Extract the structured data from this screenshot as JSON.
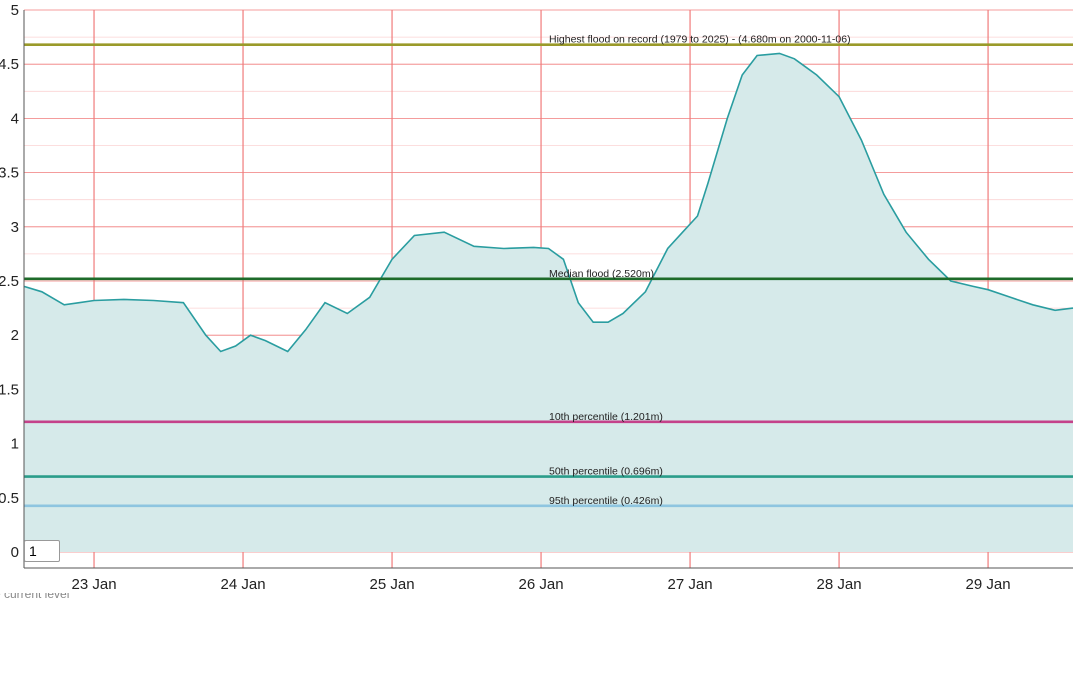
{
  "chart_data": {
    "type": "area",
    "title": "",
    "xlabel": "",
    "ylabel": "",
    "ylim": [
      0,
      5
    ],
    "y_ticks": [
      "0",
      "0.5",
      "1",
      "1.5",
      "2",
      "2.5",
      "3",
      "3.5",
      "4",
      "4.5",
      "5"
    ],
    "x_ticks": [
      "23 Jan",
      "24 Jan",
      "25 Jan",
      "26 Jan",
      "27 Jan",
      "28 Jan",
      "29 Jan"
    ],
    "x_unit": "days since 23 Jan 00:00",
    "x_range": [
      -0.47,
      6.57
    ],
    "grid": true,
    "series": [
      {
        "name": "",
        "color": "#2a9da0",
        "fill": "#d6eaea",
        "x": [
          -0.47,
          -0.35,
          -0.2,
          -0.1,
          0.0,
          0.2,
          0.4,
          0.6,
          0.75,
          0.85,
          0.95,
          1.05,
          1.15,
          1.3,
          1.42,
          1.55,
          1.7,
          1.85,
          2.0,
          2.15,
          2.35,
          2.55,
          2.75,
          2.95,
          3.05,
          3.15,
          3.25,
          3.35,
          3.45,
          3.55,
          3.7,
          3.85,
          3.95,
          4.05,
          4.12,
          4.25,
          4.35,
          4.45,
          4.6,
          4.7,
          4.75,
          4.85,
          5.0,
          5.15,
          5.3,
          5.45,
          5.6,
          5.75,
          5.9,
          6.0,
          6.15,
          6.3,
          6.45,
          6.57
        ],
        "values": [
          2.45,
          2.4,
          2.28,
          2.3,
          2.32,
          2.33,
          2.32,
          2.3,
          2.0,
          1.85,
          1.9,
          2.0,
          1.95,
          1.85,
          2.05,
          2.3,
          2.2,
          2.35,
          2.7,
          2.92,
          2.95,
          2.82,
          2.8,
          2.81,
          2.8,
          2.7,
          2.3,
          2.12,
          2.12,
          2.2,
          2.4,
          2.8,
          2.95,
          3.1,
          3.4,
          4.0,
          4.4,
          4.58,
          4.6,
          4.55,
          4.5,
          4.4,
          4.2,
          3.8,
          3.3,
          2.95,
          2.7,
          2.5,
          2.45,
          2.42,
          2.35,
          2.28,
          2.23,
          2.25
        ]
      }
    ],
    "reference_lines": [
      {
        "label": "Highest flood on record (1979 to 2025) - (4.680m on 2000-11-06)",
        "value": 4.68,
        "color": "#9a9a2a"
      },
      {
        "label": "Median flood (2.520m)",
        "value": 2.52,
        "color": "#1e6b2a"
      },
      {
        "label": "10th percentile (1.201m)",
        "value": 1.201,
        "color": "#c4428a"
      },
      {
        "label": "50th percentile (0.696m)",
        "value": 0.696,
        "color": "#2a9d8a"
      },
      {
        "label": "95th percentile (0.426m)",
        "value": 0.426,
        "color": "#8ec5e0"
      }
    ],
    "gridline_color": "#f07b7b"
  },
  "controls": {
    "level_input_value": "1",
    "footnote": "re current level"
  }
}
